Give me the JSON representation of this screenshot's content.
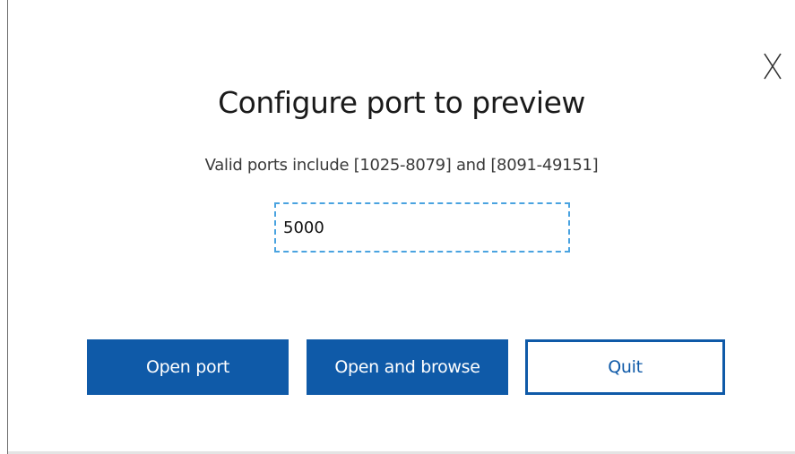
{
  "dialog": {
    "title": "Configure port to preview",
    "subtitle": "Valid ports include [1025-8079] and [8091-49151]",
    "port_input": {
      "value": "5000",
      "placeholder": ""
    },
    "close_icon": "close-icon",
    "buttons": {
      "open_port": "Open port",
      "open_and_browse": "Open and browse",
      "quit": "Quit"
    }
  },
  "colors": {
    "primary": "#0f5aa8",
    "input_focus_border": "#4aa3e0",
    "background": "#ffffff"
  }
}
